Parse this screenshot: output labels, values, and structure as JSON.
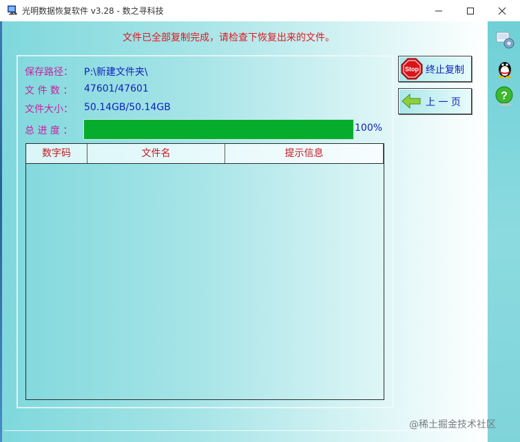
{
  "window": {
    "title": "光明数据恢复软件 v3.28 - 数之寻科技"
  },
  "status_message": "文件已全部复制完成，请检查下恢复出来的文件。",
  "fields": {
    "save_path_label": "保存路径：",
    "save_path_value": "P:\\新建文件夹\\",
    "file_count_label": "文 件 数 ：",
    "file_count_value": "47601/47601",
    "file_size_label": "文件大小：",
    "file_size_value": "50.14GB/50.14GB",
    "progress_label": "总 进 度 ：",
    "progress_text": "100%",
    "progress_fraction": 1.0
  },
  "grid": {
    "columns": [
      "数字码",
      "文件名",
      "提示信息"
    ],
    "rows": []
  },
  "buttons": {
    "stop_copy": "终止复制",
    "stop_icon_text": "Stop",
    "prev_page": "上 一 页"
  },
  "sidebar_icons": [
    "settings-icon",
    "qq-penguin-icon",
    "help-icon"
  ],
  "watermark": "@稀土掘金技术社区",
  "colors": {
    "progress_fill": "#06ad2c",
    "label_magenta": "#cc1fa0",
    "value_blue": "#1020c0",
    "alert_red": "#e0181f"
  }
}
